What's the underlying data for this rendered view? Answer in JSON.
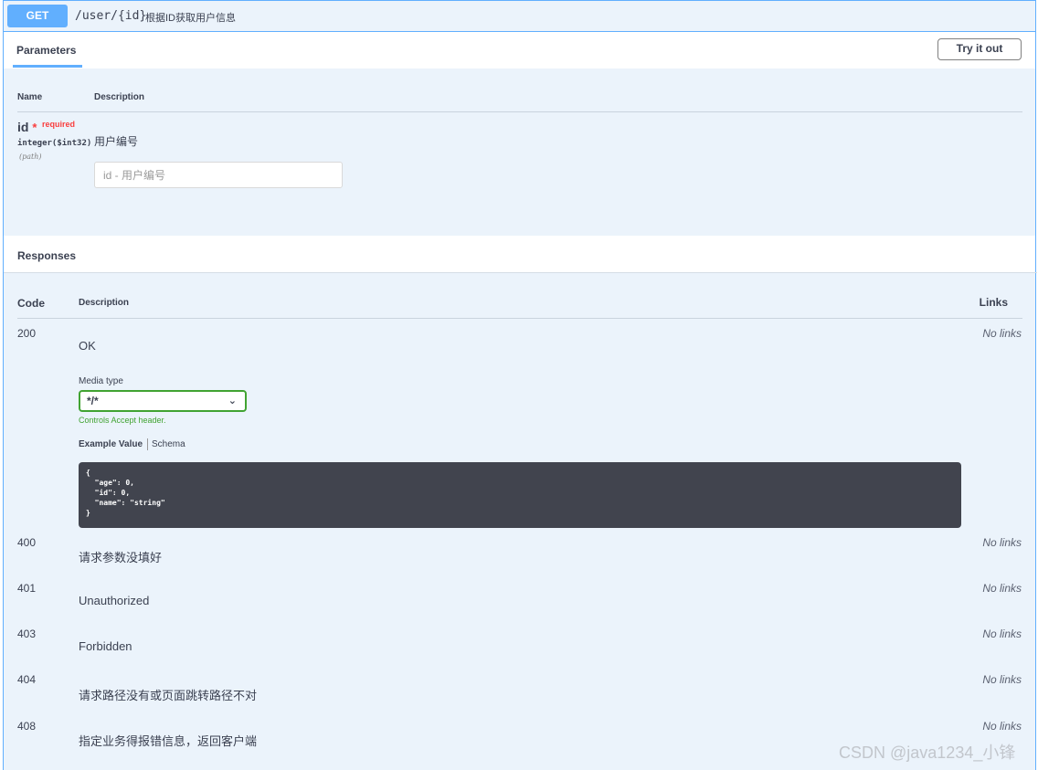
{
  "operation": {
    "method": "GET",
    "path": "/user/{id}",
    "summary": "根据ID获取用户信息"
  },
  "parameters": {
    "tab_label": "Parameters",
    "try_button": "Try it out",
    "columns": {
      "name": "Name",
      "description": "Description"
    },
    "items": [
      {
        "name": "id",
        "required_star": "*",
        "required_label": "required",
        "type": "integer($int32)",
        "location": "(path)",
        "description": "用户编号",
        "input_placeholder": "id - 用户编号"
      }
    ]
  },
  "responses": {
    "title": "Responses",
    "columns": {
      "code": "Code",
      "description": "Description",
      "links": "Links"
    },
    "media_type_label": "Media type",
    "media_type_value": "*/*",
    "controls_note": "Controls Accept header.",
    "example_tab": "Example Value",
    "schema_tab": "Schema",
    "example_body": "{\n  \"age\": 0,\n  \"id\": 0,\n  \"name\": \"string\"\n}",
    "no_links": "No links",
    "items": [
      {
        "code": "200",
        "description": "OK"
      },
      {
        "code": "400",
        "description": "请求参数没填好"
      },
      {
        "code": "401",
        "description": "Unauthorized"
      },
      {
        "code": "403",
        "description": "Forbidden"
      },
      {
        "code": "404",
        "description": "请求路径没有或页面跳转路径不对"
      },
      {
        "code": "408",
        "description": "指定业务得报错信息，返回客户端"
      }
    ]
  },
  "watermark": "CSDN @java1234_小锋",
  "colors": {
    "get_method": "#61affe",
    "required": "#f93e3e",
    "media_select_border": "#41a332",
    "code_block_bg": "#41444e"
  }
}
